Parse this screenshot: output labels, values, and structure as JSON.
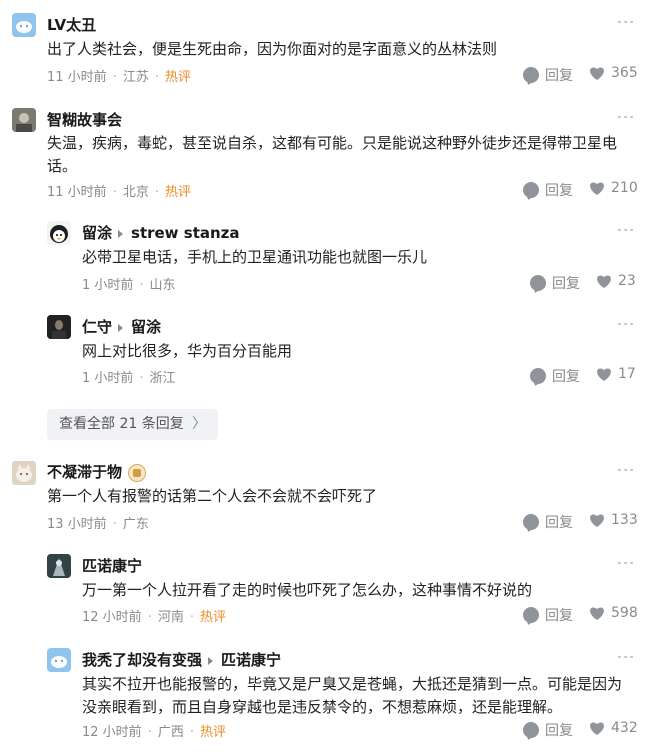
{
  "colors": {
    "hot": "#f08a24",
    "meta": "#8a8a8a",
    "expand_bg": "#f1f2f5"
  },
  "icons": {
    "more": "more-dots-icon",
    "reply": "reply-bubble-icon",
    "like": "heart-icon"
  },
  "comments": [
    {
      "name": "LV太丑",
      "text1": "出了人类社会，便是生死由命，因为你面对的是字面意义的丛林法则",
      "time": "11 小时前",
      "location": "江苏",
      "hot": "热评",
      "reply": "回复",
      "likes": "365"
    },
    {
      "name": "智糊故事会",
      "text1": "失温，疾病，毒蛇，甚至说自杀，这都有可能。只是能说这种野外徒步还是得带卫星电",
      "text2": "话。",
      "time": "11 小时前",
      "location": "北京",
      "hot": "热评",
      "reply": "回复",
      "likes": "210"
    },
    {
      "name": "留涂",
      "to": "strew stanza",
      "text1": "必带卫星电话，手机上的卫星通讯功能也就图一乐儿",
      "time": "1 小时前",
      "location": "山东",
      "reply": "回复",
      "likes": "23"
    },
    {
      "name": "仁守",
      "to": "留涂",
      "text1": "网上对比很多，华为百分百能用",
      "time": "1 小时前",
      "location": "浙江",
      "reply": "回复",
      "likes": "17"
    },
    {
      "name": "不凝滞于物",
      "text1": "第一个人有报警的话第二个人会不会就不会吓死了",
      "time": "13 小时前",
      "location": "广东",
      "reply": "回复",
      "likes": "133"
    },
    {
      "name": "匹诺康宁",
      "text1": "万一第一个人拉开看了走的时候也吓死了怎么办，这种事情不好说的",
      "time": "12 小时前",
      "location": "河南",
      "hot": "热评",
      "reply": "回复",
      "likes": "598"
    },
    {
      "name": "我秃了却没有变强",
      "to": "匹诺康宁",
      "text1": "其实不拉开也能报警的，毕竟又是尸臭又是苍蝇，大抵还是猜到一点。可能是因为",
      "text2": "没亲眼看到，而且自身穿越也是违反禁令的，不想惹麻烦，还是能理解。",
      "time": "12 小时前",
      "location": "广西",
      "hot": "热评",
      "reply": "回复",
      "likes": "432"
    }
  ],
  "expand": {
    "label": "查看全部 21 条回复",
    "chevron": "〉"
  },
  "more_glyph": "⋮"
}
